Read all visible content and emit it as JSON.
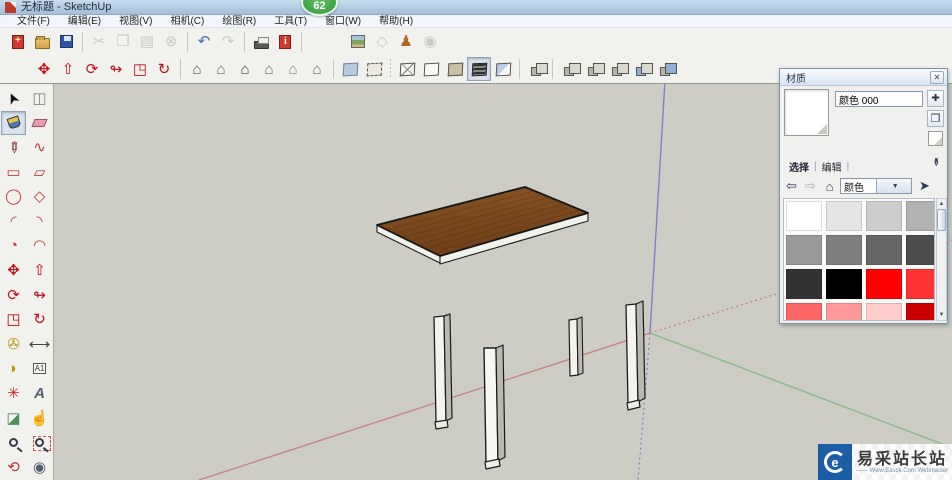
{
  "window": {
    "title": "无标题 - SketchUp",
    "badge": "62"
  },
  "menu_bar": {
    "items": [
      "文件(F)",
      "编辑(E)",
      "视图(V)",
      "相机(C)",
      "绘图(R)",
      "工具(T)",
      "窗口(W)",
      "帮助(H)"
    ]
  },
  "toolbar_standard": {
    "groups": [
      {
        "items": [
          {
            "name": "new",
            "kind": "css",
            "cls": "ic-new"
          },
          {
            "name": "open",
            "kind": "css",
            "cls": "ic-open"
          },
          {
            "name": "save",
            "kind": "css",
            "cls": "ic-save"
          }
        ]
      },
      {
        "items": [
          {
            "name": "cut",
            "glyph": "✂",
            "color": "#9a9a9a",
            "disabled": true
          },
          {
            "name": "copy",
            "glyph": "❐",
            "color": "#9a9a9a",
            "disabled": true
          },
          {
            "name": "paste",
            "glyph": "▤",
            "color": "#9a9a9a",
            "disabled": true
          },
          {
            "name": "erase",
            "glyph": "⊗",
            "color": "#9a9a9a",
            "disabled": true
          }
        ]
      },
      {
        "items": [
          {
            "name": "undo",
            "glyph": "↶",
            "color": "#3f6eb5"
          },
          {
            "name": "redo",
            "glyph": "↷",
            "color": "#9a9a9a",
            "disabled": true
          }
        ]
      },
      {
        "items": [
          {
            "name": "print",
            "kind": "css",
            "cls": "ic-print"
          },
          {
            "name": "model-info",
            "kind": "css",
            "cls": "ic-info"
          }
        ]
      },
      {
        "gap": 40,
        "items": [
          {
            "name": "add-location",
            "kind": "css",
            "cls": "ic-geo"
          },
          {
            "name": "toggle-terrain",
            "glyph": "◇",
            "color": "#9a9a9a",
            "disabled": true
          },
          {
            "name": "photo-textures",
            "glyph": "♟",
            "color": "#b06820"
          },
          {
            "name": "google-earth",
            "glyph": "◉",
            "color": "#9a9a9a",
            "disabled": true
          }
        ]
      }
    ]
  },
  "toolbar_second": {
    "groups": [
      {
        "items": [
          {
            "name": "move",
            "glyph": "✥",
            "color": "#be0e18"
          },
          {
            "name": "push-pull",
            "glyph": "⇧",
            "color": "#be0e18"
          },
          {
            "name": "rotate",
            "glyph": "⟳",
            "color": "#be0e18"
          },
          {
            "name": "follow-me",
            "glyph": "↬",
            "color": "#be0e18"
          },
          {
            "name": "scale",
            "glyph": "◳",
            "color": "#be0e18"
          },
          {
            "name": "offset",
            "glyph": "↻",
            "color": "#be0e18"
          }
        ]
      },
      {
        "items": [
          {
            "name": "view-iso",
            "glyph": "⌂",
            "color": "#55504a"
          },
          {
            "name": "view-top",
            "glyph": "⌂",
            "color": "#6b665f"
          },
          {
            "name": "view-front",
            "glyph": "⌂",
            "color": "#44403b"
          },
          {
            "name": "view-right",
            "glyph": "⌂",
            "color": "#6b665f"
          },
          {
            "name": "view-back",
            "glyph": "⌂",
            "color": "#8a857d"
          },
          {
            "name": "view-left",
            "glyph": "⌂",
            "color": "#6b665f"
          }
        ]
      },
      {
        "items": [
          {
            "name": "style-xray",
            "kind": "css",
            "cls": "cube xray"
          },
          {
            "name": "style-back-edges",
            "kind": "css",
            "cls": "cube backedge"
          }
        ]
      },
      {
        "dotted": true,
        "items": [
          {
            "name": "style-wireframe",
            "kind": "css",
            "cls": "cube wire"
          },
          {
            "name": "style-hidden-line",
            "kind": "css",
            "cls": "cube white"
          },
          {
            "name": "style-shaded",
            "kind": "css",
            "cls": "cube tan"
          },
          {
            "name": "style-shaded-textures",
            "kind": "css",
            "cls": "cube tex",
            "pressed": true
          },
          {
            "name": "style-monochrome",
            "kind": "css",
            "cls": "cube mono"
          }
        ]
      },
      {
        "items": [
          {
            "name": "solid-outer-shell",
            "kind": "css",
            "cls": "pair"
          }
        ]
      },
      {
        "items": [
          {
            "name": "solid-intersect",
            "kind": "css",
            "cls": "pair"
          },
          {
            "name": "solid-union",
            "kind": "css",
            "cls": "pair"
          },
          {
            "name": "solid-subtract",
            "kind": "css",
            "cls": "pair"
          },
          {
            "name": "solid-trim",
            "kind": "css",
            "cls": "pair blue"
          },
          {
            "name": "solid-split",
            "kind": "css",
            "cls": "pair blue2"
          }
        ]
      }
    ]
  },
  "left_toolbar": {
    "items": [
      {
        "name": "select",
        "glyph": "➤",
        "color": "#111",
        "rot": -115
      },
      {
        "name": "make-component",
        "glyph": "◫",
        "color": "#8a857d"
      },
      {
        "name": "paint-bucket",
        "kind": "css",
        "cls": "ic-bucket",
        "pressed": true
      },
      {
        "name": "eraser",
        "kind": "css",
        "cls": "ic-eraser"
      },
      {
        "name": "line",
        "glyph": "✏",
        "color": "#7a1f1f",
        "rot": 90
      },
      {
        "name": "freehand",
        "glyph": "∿",
        "color": "#c03a3a"
      },
      {
        "name": "rectangle",
        "glyph": "▭",
        "color": "#c03a3a"
      },
      {
        "name": "rotated-rectangle",
        "glyph": "▱",
        "color": "#c03a3a"
      },
      {
        "name": "circle",
        "glyph": "◯",
        "color": "#c03a3a"
      },
      {
        "name": "polygon",
        "glyph": "◇",
        "color": "#c03a3a"
      },
      {
        "name": "arc",
        "glyph": "◜",
        "color": "#c03a3a"
      },
      {
        "name": "two-point-arc",
        "glyph": "◝",
        "color": "#c03a3a"
      },
      {
        "name": "pie",
        "glyph": "◔",
        "color": "#c03a3a"
      },
      {
        "name": "curve",
        "glyph": "◠",
        "color": "#c03a3a"
      },
      {
        "name": "move",
        "glyph": "✥",
        "color": "#be0e18"
      },
      {
        "name": "push-pull",
        "glyph": "⇧",
        "color": "#be0e18"
      },
      {
        "name": "rotate",
        "glyph": "⟳",
        "color": "#be0e18"
      },
      {
        "name": "follow-me",
        "glyph": "↬",
        "color": "#be0e18"
      },
      {
        "name": "scale",
        "glyph": "◳",
        "color": "#be0e18"
      },
      {
        "name": "offset",
        "glyph": "↻",
        "color": "#be0e18"
      },
      {
        "name": "tape-measure",
        "glyph": "✇",
        "color": "#b8960a"
      },
      {
        "name": "dimension",
        "glyph": "⟷",
        "color": "#44403b"
      },
      {
        "name": "protractor",
        "glyph": "◗",
        "color": "#b8960a"
      },
      {
        "name": "text",
        "kind": "css",
        "cls": "ic-textbox",
        "text": "A1"
      },
      {
        "name": "axes",
        "glyph": "✳",
        "color": "#cc2222"
      },
      {
        "name": "3d-text",
        "glyph": "A",
        "color": "#55606e",
        "bold": true
      },
      {
        "name": "section-plane",
        "glyph": "◪",
        "color": "#4d8f5d"
      },
      {
        "name": "pan",
        "glyph": "☝",
        "color": "#333333"
      },
      {
        "name": "zoom",
        "kind": "css",
        "cls": "ic-zoom"
      },
      {
        "name": "zoom-window",
        "kind": "css",
        "cls": "ic-zoom ic-zoomwin"
      },
      {
        "name": "orbit",
        "glyph": "⟲",
        "color": "#b03a3a"
      },
      {
        "name": "zoom-extents",
        "glyph": "◉",
        "color": "#55606e"
      }
    ]
  },
  "materials_panel": {
    "title": "材质",
    "name_value": "颜色 000",
    "tabs": [
      "选择",
      "编辑"
    ],
    "collection": "颜色",
    "icons": [
      "close-icon",
      "create-material-icon",
      "set-default-paint-icon",
      "sample-paint-icon",
      "eyedropper-icon",
      "back-icon",
      "forward-icon",
      "home-icon",
      "dropdown-arrow-icon",
      "in-model-icon",
      "scroll-up-icon",
      "scroll-down-icon"
    ],
    "swatches": [
      "#FFFFFF",
      "#E5E5E5",
      "#CCCCCC",
      "#B2B2B2",
      "#999999",
      "#7F7F7F",
      "#666666",
      "#4C4C4C",
      "#333333",
      "#000000",
      "#FF0000",
      "#FF3333",
      "#FF6666",
      "#FF9999",
      "#FFCCCC",
      "#CC0000"
    ]
  },
  "viewport": {
    "background": "#cdcdc6",
    "axes": {
      "red": "#c97f7f",
      "green": "#8fbb8f",
      "blue": "#8080c8"
    },
    "model": {
      "description": "wooden table with four white legs",
      "wood_color": "#7b4a21"
    }
  },
  "watermark": {
    "text": "易采站长站",
    "subtext": "—— Www.Easck.Com Webmaster"
  }
}
